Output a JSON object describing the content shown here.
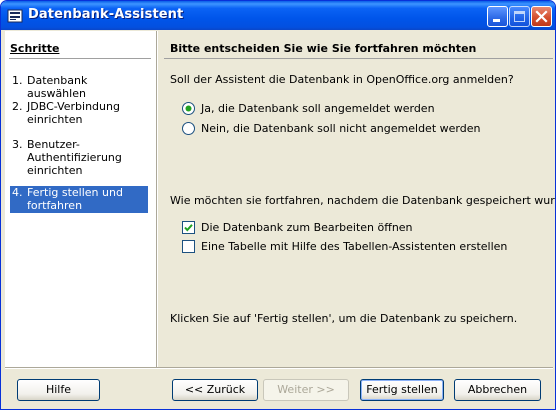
{
  "window": {
    "title": "Datenbank-Assistent"
  },
  "steps": {
    "heading": "Schritte",
    "items": [
      {
        "num": "1.",
        "label": "Datenbank auswählen"
      },
      {
        "num": "2.",
        "label": "JDBC-Verbindung einrichten"
      },
      {
        "num": "3.",
        "label": "Benutzer-Authentifizierung einrichten"
      },
      {
        "num": "4.",
        "label": "Fertig stellen und fortfahren"
      }
    ],
    "active_index": 3
  },
  "content": {
    "heading": "Bitte entscheiden Sie wie Sie fortfahren möchten",
    "register_question": "Soll der Assistent die Datenbank in OpenOffice.org anmelden?",
    "register_yes": "Ja, die Datenbank soll angemeldet werden",
    "register_no": "Nein, die Datenbank soll nicht angemeldet werden",
    "register_selected": "yes",
    "continue_question": "Wie möchten sie fortfahren, nachdem die Datenbank gespeichert wurde?",
    "open_for_edit": "Die Datenbank zum  Bearbeiten öffnen",
    "open_for_edit_checked": true,
    "create_table": "Eine Tabelle mit Hilfe des Tabellen-Assistenten erstellen",
    "create_table_checked": false,
    "finish_hint": "Klicken Sie auf 'Fertig stellen', um die Datenbank zu speichern."
  },
  "buttons": {
    "help": "Hilfe",
    "back": "<< Zurück",
    "next": "Weiter >>",
    "finish": "Fertig stellen",
    "cancel": "Abbrechen"
  },
  "colors": {
    "selection": "#316ac5",
    "titlebar": "#0055ea",
    "dialog_bg": "#ece9d8"
  }
}
